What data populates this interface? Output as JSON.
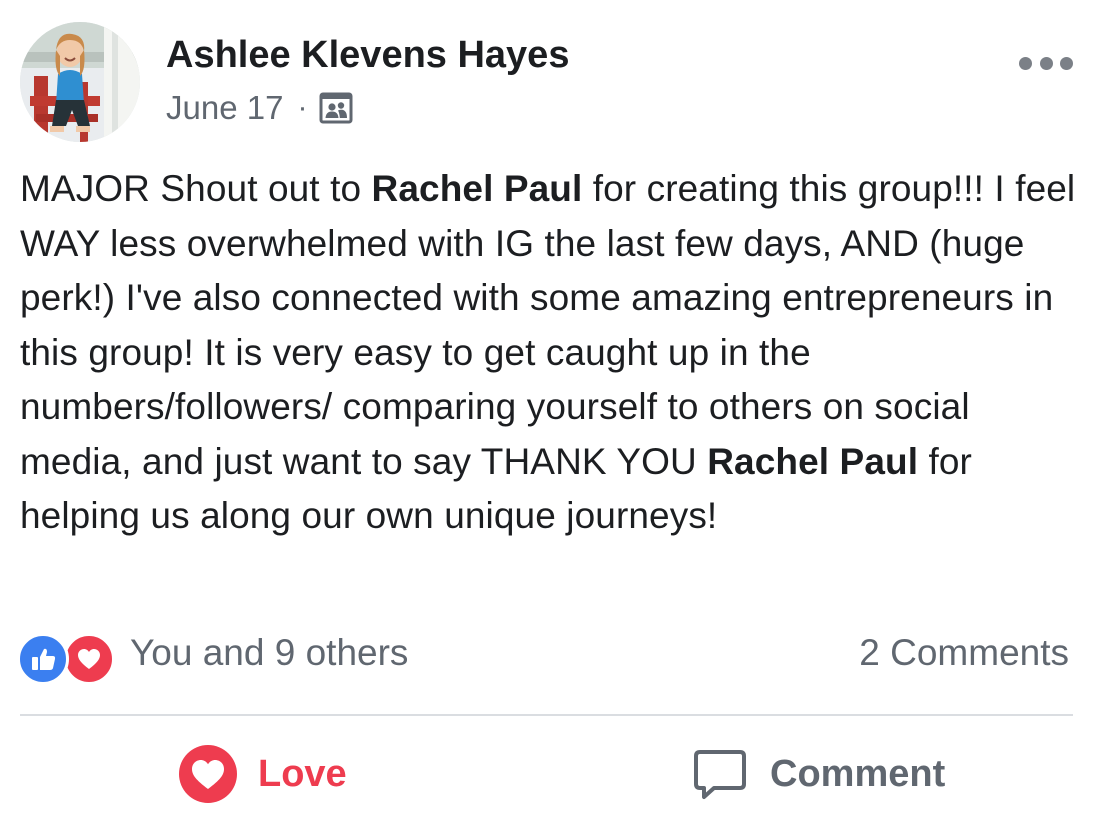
{
  "post": {
    "author": "Ashlee Klevens Hayes",
    "date": "June 17",
    "separator": "·",
    "audience_icon": "group-icon",
    "more_icon": "more-options-icon",
    "body": {
      "segments": [
        {
          "text": "MAJOR Shout out to ",
          "bold": false
        },
        {
          "text": "Rachel Paul",
          "bold": true
        },
        {
          "text": " for creating this group!!! I feel WAY less overwhelmed with IG the last few days, AND (huge perk!) I've also connected with some amazing entrepreneurs in this group! It is very easy to get caught up in the numbers/followers/ comparing yourself to others on social media, and just want to say THANK YOU ",
          "bold": false
        },
        {
          "text": "Rachel Paul",
          "bold": true
        },
        {
          "text": " for helping us along our own unique journeys!",
          "bold": false
        }
      ]
    }
  },
  "reactions": {
    "icons": [
      "like-icon",
      "love-icon"
    ],
    "summary": "You and 9 others",
    "comments": "2 Comments"
  },
  "actions": {
    "love_label": "Love",
    "comment_label": "Comment"
  },
  "colors": {
    "love": "#ee3c4f",
    "like": "#3b7ff0",
    "secondary_text": "#606770",
    "primary_text": "#1c1e21",
    "divider": "#dadde1"
  }
}
